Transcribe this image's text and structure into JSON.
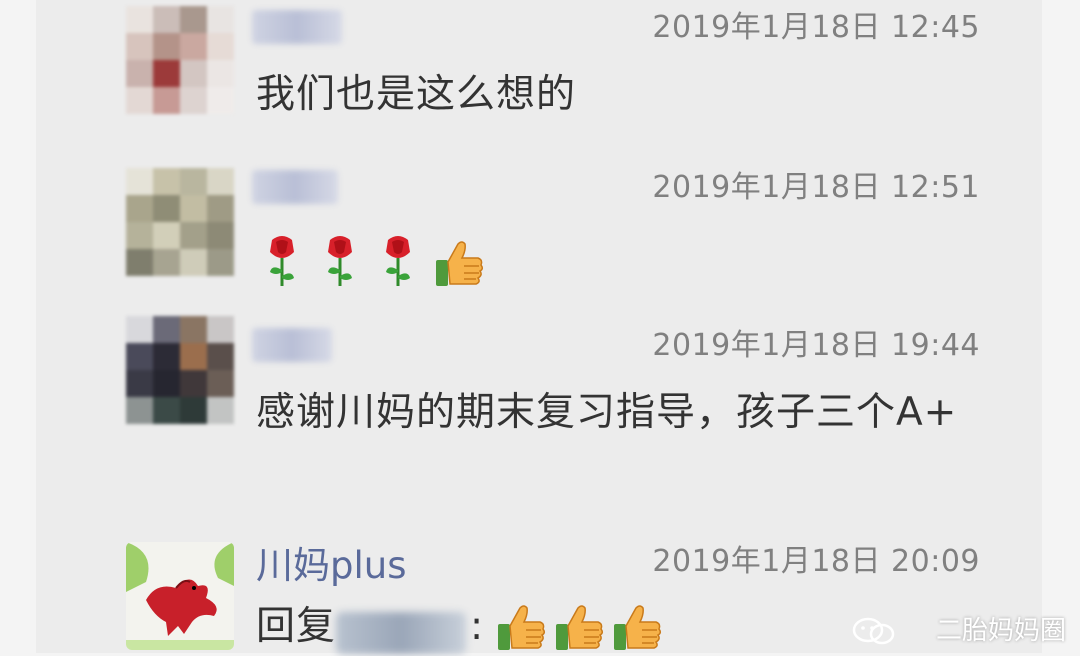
{
  "messages": [
    {
      "time": "2019年1月18日 12:45",
      "text": "我们也是这么想的"
    },
    {
      "time": "2019年1月18日 12:51"
    },
    {
      "time": "2019年1月18日 19:44",
      "text": "感谢川妈的期末复习指导，孩子三个A+"
    },
    {
      "name": "川妈plus",
      "time": "2019年1月18日 20:09",
      "reply_prefix": "回复",
      "reply_colon": ":"
    }
  ],
  "watermark": "二胎妈妈圈",
  "icons": {
    "rose": "rose-icon",
    "thumbs_up": "thumbs-up-icon",
    "wechat": "wechat-icon"
  },
  "colors": {
    "name_link": "#5a6a9a",
    "timestamp": "#808080",
    "text": "#333333"
  }
}
